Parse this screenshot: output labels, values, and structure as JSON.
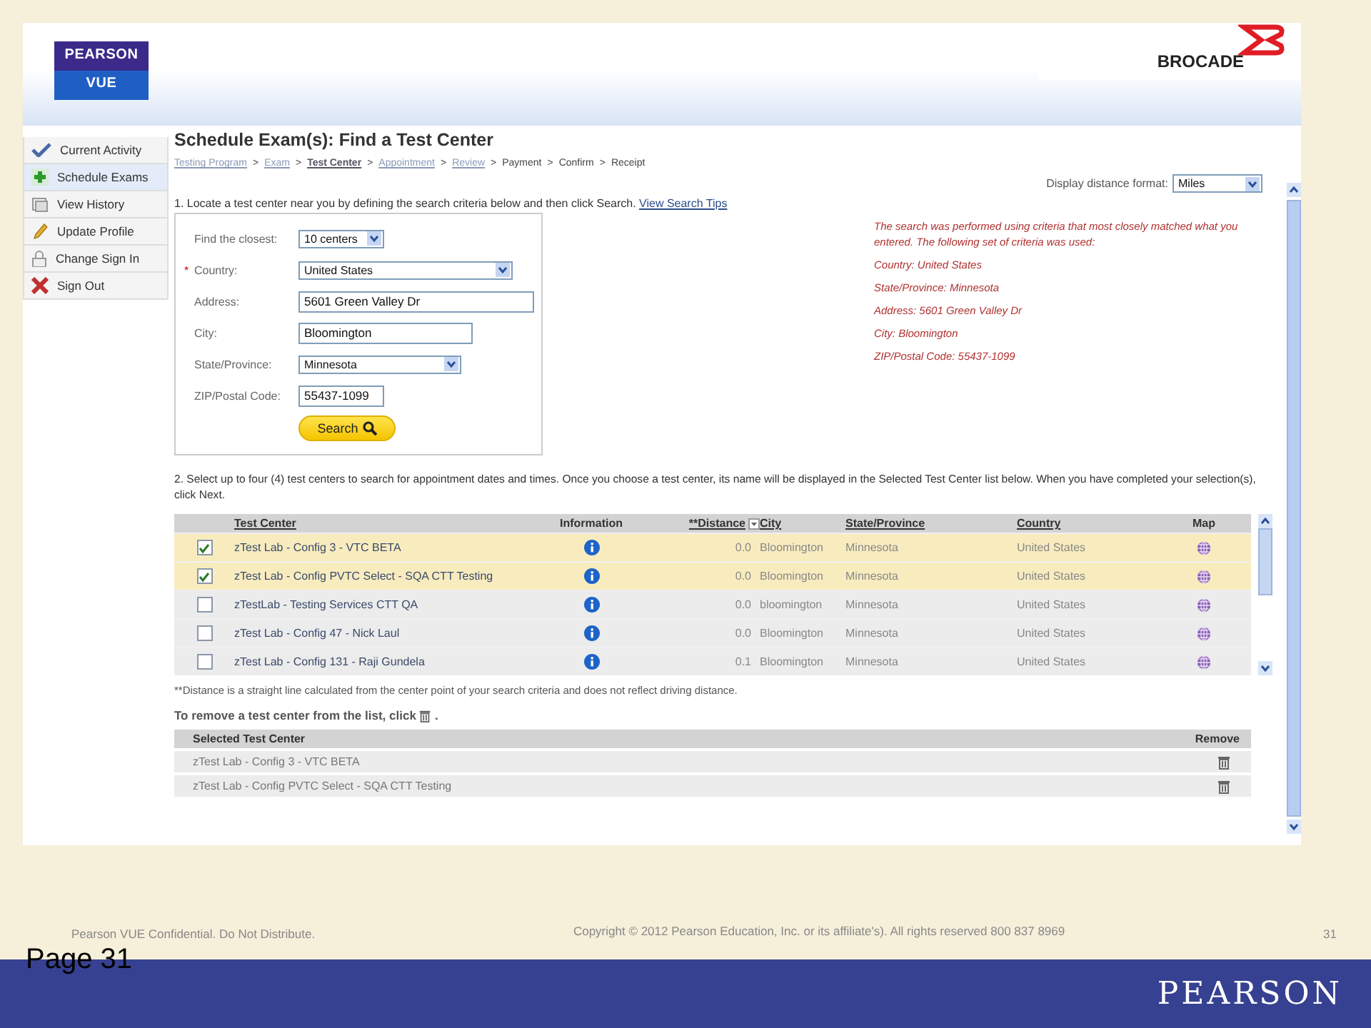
{
  "header": {
    "logo_top": "PEARSON",
    "logo_bottom": "VUE",
    "partner": "BROCADE"
  },
  "sidebar": {
    "items": [
      {
        "label": "Current Activity",
        "selected": false
      },
      {
        "label": "Schedule Exams",
        "selected": true
      },
      {
        "label": "View History",
        "selected": false
      },
      {
        "label": "Update Profile",
        "selected": false
      },
      {
        "label": "Change Sign In",
        "selected": false
      },
      {
        "label": "Sign Out",
        "selected": false
      }
    ]
  },
  "title": "Schedule Exam(s): Find a Test Center",
  "breadcrumb": [
    {
      "label": "Testing Program",
      "kind": "link"
    },
    {
      "label": "Exam",
      "kind": "link"
    },
    {
      "label": "Test Center",
      "kind": "current"
    },
    {
      "label": "Appointment",
      "kind": "link"
    },
    {
      "label": "Review",
      "kind": "link"
    },
    {
      "label": "Payment",
      "kind": "text"
    },
    {
      "label": "Confirm",
      "kind": "text"
    },
    {
      "label": "Receipt",
      "kind": "text"
    }
  ],
  "breadcrumb_separator": ">",
  "distance_format": {
    "label": "Display distance format:",
    "value": "Miles"
  },
  "step1": {
    "text": "1. Locate a test center near you by defining the search criteria below and then click Search.",
    "link": "View Search Tips"
  },
  "search_form": {
    "required_marker": "*",
    "fields": [
      {
        "label": "Find the closest:",
        "kind": "select",
        "value": "10 centers",
        "required": false
      },
      {
        "label": "Country:",
        "kind": "select",
        "value": "United States",
        "required": true
      },
      {
        "label": "Address:",
        "kind": "input",
        "value": "5601 Green Valley Dr",
        "required": false
      },
      {
        "label": "City:",
        "kind": "input",
        "value": "Bloomington",
        "required": false
      },
      {
        "label": "State/Province:",
        "kind": "select",
        "value": "Minnesota",
        "required": false
      },
      {
        "label": "ZIP/Postal Code:",
        "kind": "input",
        "value": "55437-1099",
        "required": false
      }
    ],
    "button": "Search"
  },
  "criteria_note": [
    "The search was performed using criteria that most closely matched what you entered. The following set of criteria was used:",
    "Country: United States",
    "State/Province: Minnesota",
    "Address: 5601 Green Valley Dr",
    "City: Bloomington",
    "ZIP/Postal Code: 55437-1099"
  ],
  "step2": "2. Select up to four (4) test centers to search for appointment dates and times. Once you choose a test center, its name will be displayed in the Selected Test Center list below. When you have completed your selection(s), click Next.",
  "table": {
    "columns": [
      {
        "label": "Test Center",
        "link": true
      },
      {
        "label": "Information",
        "link": false
      },
      {
        "label": "**Distance",
        "link": true
      },
      {
        "label": "City",
        "link": true
      },
      {
        "label": "State/Province",
        "link": true
      },
      {
        "label": "Country",
        "link": true
      },
      {
        "label": "Map",
        "link": false
      }
    ],
    "rows": [
      {
        "checked": true,
        "name": "zTest Lab - Config 3 - VTC BETA",
        "distance": "0.0",
        "city": "Bloomington",
        "state": "Minnesota",
        "country": "United States"
      },
      {
        "checked": true,
        "name": "zTest Lab - Config PVTC Select - SQA CTT Testing",
        "distance": "0.0",
        "city": "Bloomington",
        "state": "Minnesota",
        "country": "United States"
      },
      {
        "checked": false,
        "name": "zTestLab - Testing Services CTT QA",
        "distance": "0.0",
        "city": "bloomington",
        "state": "Minnesota",
        "country": "United States"
      },
      {
        "checked": false,
        "name": "zTest Lab - Config 47 - Nick Laul",
        "distance": "0.0",
        "city": "Bloomington",
        "state": "Minnesota",
        "country": "United States"
      },
      {
        "checked": false,
        "name": "zTest Lab - Config 131 - Raji Gundela",
        "distance": "0.1",
        "city": "Bloomington",
        "state": "Minnesota",
        "country": "United States"
      }
    ]
  },
  "footnote": "**Distance is a straight line calculated from the center point of your search criteria and does not reflect driving distance.",
  "remove_note": {
    "before": "To remove a test center from the list, click",
    "after": "."
  },
  "selected_table": {
    "columns": [
      "Selected Test Center",
      "Remove"
    ],
    "rows": [
      "zTest Lab - Config 3 - VTC BETA",
      "zTest Lab - Config PVTC Select - SQA CTT Testing"
    ]
  },
  "footer": {
    "confidential": "Pearson VUE Confidential. Do Not Distribute.",
    "copyright": "Copyright © 2012 Pearson Education, Inc. or its affiliate's). All rights reserved 800 837 8969",
    "page_number": "31",
    "page_label": "Page 31",
    "brand": "PEARSON"
  }
}
